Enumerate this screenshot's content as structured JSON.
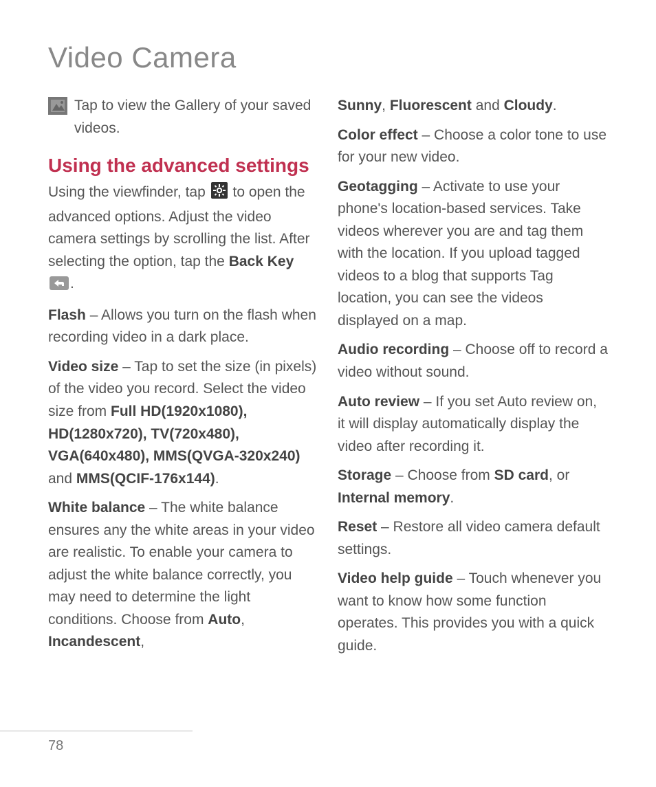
{
  "page_title": "Video Camera",
  "page_number": "78",
  "left": {
    "gallery_text": "Tap to view the Gallery of your saved videos.",
    "section_heading": "Using the advanced settings",
    "intro_a": "Using the viewfinder, tap ",
    "intro_b": " to open the advanced options. Adjust the video camera settings by scrolling the list. After selecting the option, tap the ",
    "back_key": "Back Key",
    "intro_c": ".",
    "flash_label": "Flash",
    "flash_text": " – Allows you turn on the flash when recording video in a dark place.",
    "vsize_label": "Video size",
    "vsize_a": " – Tap to set the size (in pixels) of the video you record. Select the video size from ",
    "vsize_opts": "Full HD(1920x1080), HD(1280x720), TV(720x480), VGA(640x480), MMS(QVGA-320x240)",
    "vsize_and": " and ",
    "vsize_last": "MMS(QCIF-176x144)",
    "vsize_end": ".",
    "wb_label": "White balance",
    "wb_a": " – The white balance ensures any the white areas in your video are realistic. To enable your camera to adjust the white balance correctly, you may need to determine the light conditions. Choose from ",
    "wb_auto": "Auto",
    "wb_sep1": ", ",
    "wb_inc": "Incandescent",
    "wb_sep2": ", "
  },
  "right": {
    "wb_sunny": "Sunny",
    "wb_sep3": ", ",
    "wb_fluo": "Fluorescent",
    "wb_and": " and ",
    "wb_cloudy": "Cloudy",
    "wb_end": ".",
    "ce_label": "Color effect",
    "ce_text": " – Choose a color tone to use for your new video.",
    "geo_label": "Geotagging",
    "geo_text": " – Activate to use your phone's location-based services. Take videos wherever you are and tag them with the location. If you upload tagged videos to a blog that supports Tag location, you can see the videos displayed on a map.",
    "ar_label": "Audio recording",
    "ar_text": " – Choose off to record a video without sound.",
    "arev_label": "Auto review",
    "arev_text": " – If you set Auto review on, it will display automatically display the video after recording it.",
    "st_label": "Storage",
    "st_a": " – Choose from ",
    "st_sd": "SD card",
    "st_sep": ", or ",
    "st_im": "Internal memory",
    "st_end": ".",
    "rs_label": "Reset",
    "rs_text": " – Restore all video camera default settings.",
    "hg_label": "Video help guide",
    "hg_text": " – Touch whenever you want to know how some function operates. This provides you with a quick guide."
  }
}
